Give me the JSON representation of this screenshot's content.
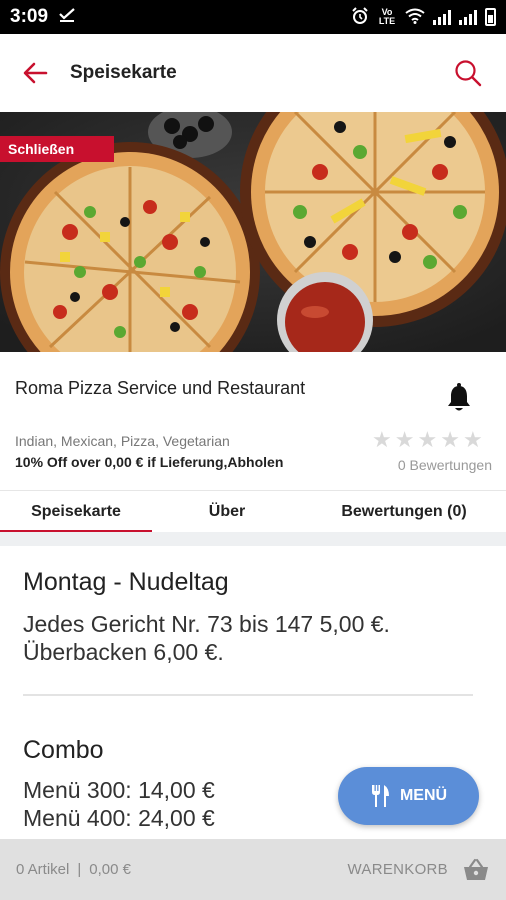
{
  "status_bar": {
    "time": "3:09",
    "notification_icon": "download-done-icon",
    "system_icons": [
      "alarm-icon",
      "volte-icon",
      "wifi-icon",
      "signal-icon",
      "battery-icon"
    ],
    "volte_text": "Vo LTE"
  },
  "app_bar": {
    "title": "Speisekarte",
    "back_icon": "arrow-back-icon",
    "search_icon": "search-icon",
    "accent_color": "#c8102e"
  },
  "hero": {
    "badge": "Schließen",
    "image": "pizza-photo"
  },
  "restaurant": {
    "name": "Roma Pizza Service und Restaurant",
    "cuisines": "Indian, Mexican, Pizza, Vegetarian",
    "offer": "10% Off over 0,00 € if Lieferung,Abholen",
    "rating_stars": 0,
    "rating_count": "0 Bewertungen"
  },
  "tabs": [
    {
      "label": "Speisekarte",
      "active": true
    },
    {
      "label": "Über",
      "active": false
    },
    {
      "label": "Bewertungen (0)",
      "active": false
    }
  ],
  "sections": [
    {
      "title": "Montag - Nudeltag",
      "body": "Jedes Gericht Nr. 73 bis 147 5,00 €.\nÜberbacken 6,00 €."
    },
    {
      "title": "Combo",
      "body": "Menü 300: 14,00 €\nMenü 400: 24,00 €"
    }
  ],
  "fab": {
    "label": "MENÜ",
    "icon": "cutlery-icon",
    "color": "#5b8ed8"
  },
  "bottom_bar": {
    "items": "0 Artikel",
    "separator": "|",
    "total": "0,00 €",
    "cart_label": "WARENKORB",
    "cart_icon": "basket-icon"
  }
}
